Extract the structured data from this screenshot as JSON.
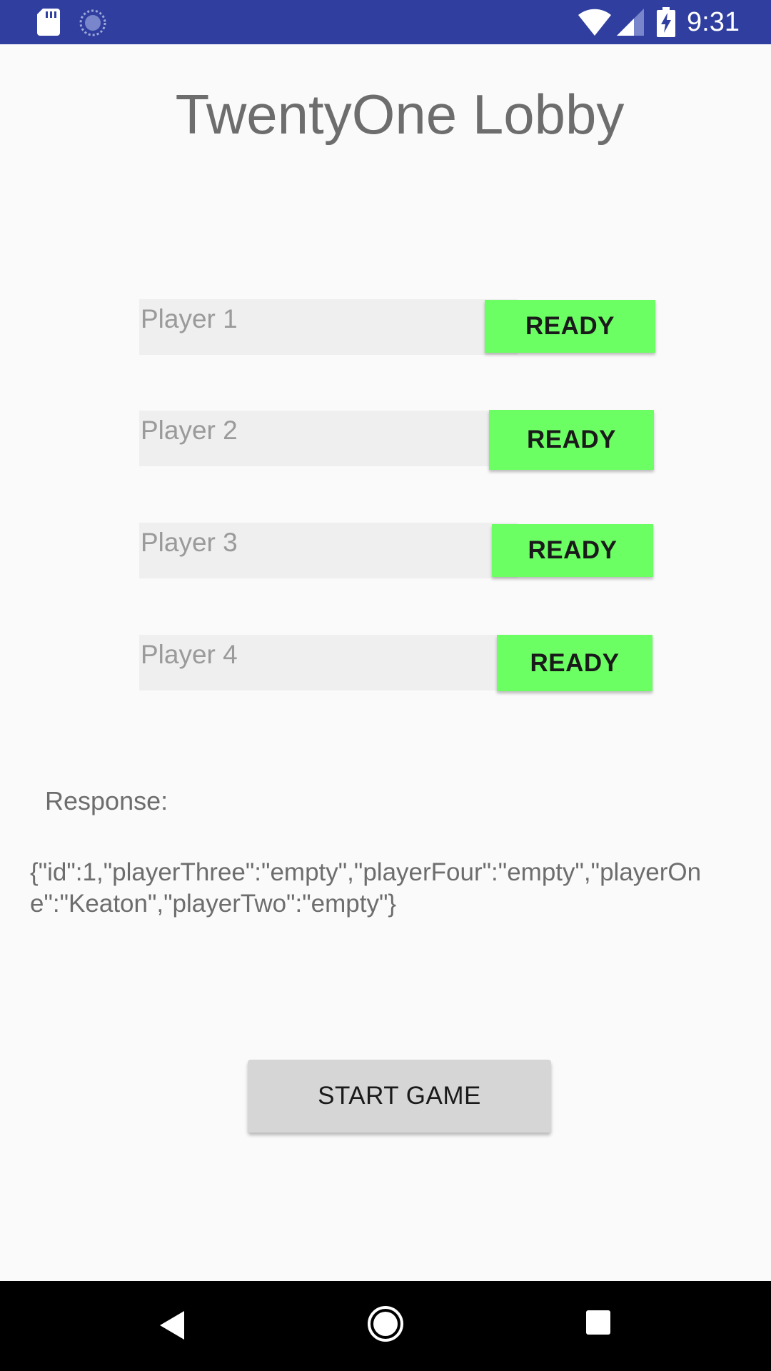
{
  "status_bar": {
    "time": "9:31",
    "icons": [
      "sd-card-icon",
      "sync-icon",
      "wifi-icon",
      "signal-icon",
      "battery-charging-icon"
    ],
    "background_color": "#303f9f"
  },
  "page": {
    "title": "TwentyOne Lobby",
    "background_color": "#fafafa"
  },
  "players": [
    {
      "placeholder": "Player 1",
      "ready_label": "READY"
    },
    {
      "placeholder": "Player 2",
      "ready_label": "READY"
    },
    {
      "placeholder": "Player 3",
      "ready_label": "READY"
    },
    {
      "placeholder": "Player 4",
      "ready_label": "READY"
    }
  ],
  "ready_button_color": "#6bff63",
  "response": {
    "label": "Response:",
    "text": "{\"id\":1,\"playerThree\":\"empty\",\"playerFour\":\"empty\",\"playerOne\":\"Keaton\",\"playerTwo\":\"empty\"}"
  },
  "start_button": {
    "label": "START GAME"
  },
  "nav_bar": {
    "buttons": [
      "back-icon",
      "home-icon",
      "recents-icon"
    ]
  }
}
